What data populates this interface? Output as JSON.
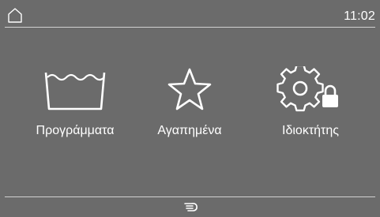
{
  "header": {
    "home_icon": "home-icon",
    "time": "11:02"
  },
  "menu": {
    "items": [
      {
        "label": "Προγράμματα",
        "icon": "washing-tub-icon"
      },
      {
        "label": "Αγαπημένα",
        "icon": "star-icon"
      },
      {
        "label": "Ιδιοκτήτης",
        "icon": "gear-lock-icon"
      }
    ]
  },
  "footer": {
    "icon": "touch-hand-icon"
  },
  "colors": {
    "background": "#6b6b6b",
    "foreground": "#ffffff",
    "divider": "#d0d0d0"
  }
}
